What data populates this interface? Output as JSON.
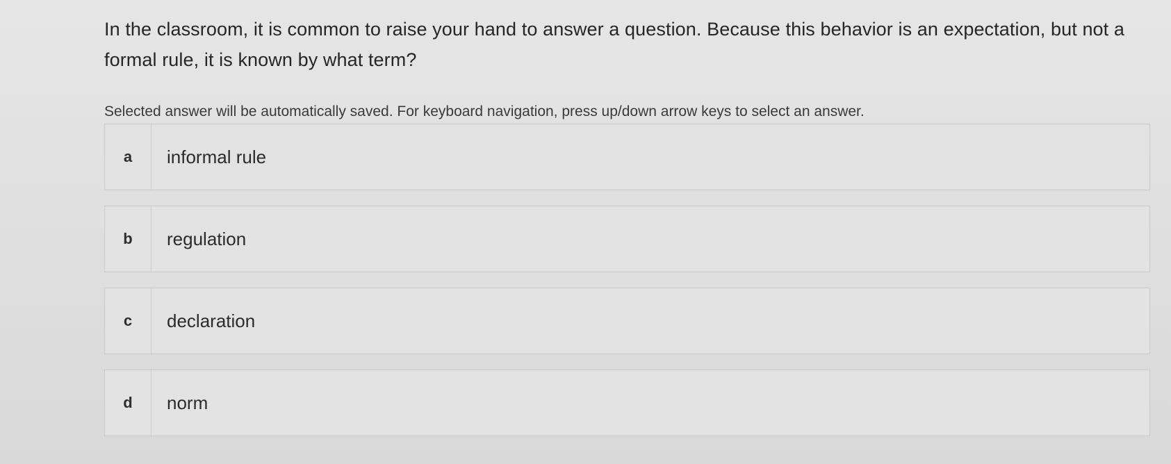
{
  "question": {
    "text": "In the classroom, it is common to raise your hand to answer a question. Because this behavior is an expectation, but not a formal rule, it is known by what term?"
  },
  "instructions": {
    "text": "Selected answer will be automatically saved. For keyboard navigation, press up/down arrow keys to select an answer."
  },
  "choices": [
    {
      "letter": "a",
      "text": "informal rule"
    },
    {
      "letter": "b",
      "text": "regulation"
    },
    {
      "letter": "c",
      "text": "declaration"
    },
    {
      "letter": "d",
      "text": "norm"
    }
  ]
}
